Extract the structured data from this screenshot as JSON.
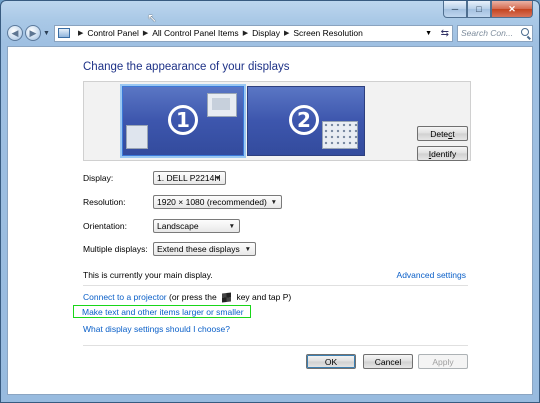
{
  "window": {
    "minimize_glyph": "─",
    "maximize_glyph": "□",
    "close_glyph": "✕"
  },
  "nav": {
    "back_glyph": "◀",
    "forward_glyph": "▶",
    "breadcrumbs": [
      "Control Panel",
      "All Control Panel Items",
      "Display",
      "Screen Resolution"
    ],
    "search_placeholder": "Search Con..."
  },
  "page": {
    "title": "Change the appearance of your displays"
  },
  "preview": {
    "monitor1_number": "1",
    "monitor2_number": "2",
    "detect_label_pre": "Dete",
    "detect_label_mn": "c",
    "detect_label_post": "t",
    "identify_label_mn": "I",
    "identify_label_post": "dentify"
  },
  "settings": {
    "display_label": "Display:",
    "display_value": "1. DELL P2214H",
    "resolution_label": "Resolution:",
    "resolution_value": "1920 × 1080 (recommended)",
    "orientation_label": "Orientation:",
    "orientation_value": "Landscape",
    "multiple_label": "Multiple displays:",
    "multiple_value": "Extend these displays"
  },
  "info": {
    "main_display_note": "This is currently your main display.",
    "advanced_link": "Advanced settings"
  },
  "links": {
    "projector_link": "Connect to a projector",
    "projector_suffix_a": " (or press the ",
    "projector_suffix_b": " key and tap P)",
    "text_larger_link": "Make text and other items larger or smaller",
    "what_settings_link": "What display settings should I choose?"
  },
  "buttons": {
    "ok": "OK",
    "cancel": "Cancel",
    "apply": "Apply"
  },
  "colors": {
    "link": "#0a5fc8",
    "title": "#1e3287",
    "highlight": "#19d619"
  }
}
